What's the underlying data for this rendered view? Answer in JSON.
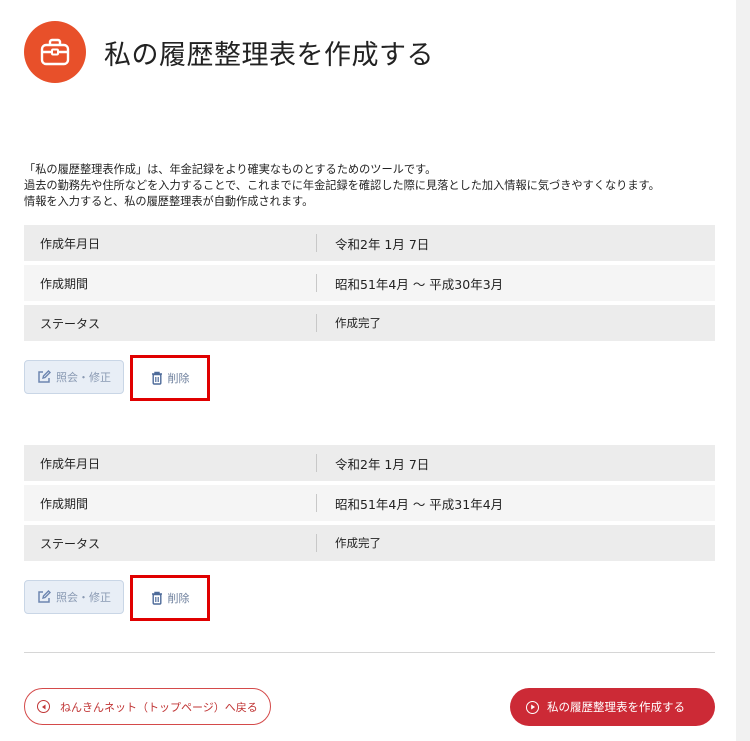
{
  "page": {
    "title": "私の履歴整理表を作成する",
    "icon": "toolbox-icon",
    "accent_color": "#e8502a"
  },
  "intro": {
    "line1": "「私の履歴整理表作成」は、年金記録をより確実なものとするためのツールです。",
    "line2": "過去の勤務先や住所などを入力することで、これまでに年金記録を確認した際に見落とした加入情報に気づきやすくなります。",
    "line3": "情報を入力すると、私の履歴整理表が自動作成されます。"
  },
  "records": [
    {
      "created_label": "作成年月日",
      "created_value": "令和2年 1月 7日",
      "period_label": "作成期間",
      "period_value": "昭和51年4月 ～ 平成30年3月",
      "status_label": "ステータス",
      "status_value": "作成完了",
      "edit_label": "照会・修正",
      "delete_label": "削除"
    },
    {
      "created_label": "作成年月日",
      "created_value": "令和2年 1月 7日",
      "period_label": "作成期間",
      "period_value": "昭和51年4月 ～ 平成31年4月",
      "status_label": "ステータス",
      "status_value": "作成完了",
      "edit_label": "照会・修正",
      "delete_label": "削除"
    }
  ],
  "footer": {
    "back_label": "ねんきんネット（トップページ）へ戻る",
    "create_label": "私の履歴整理表を作成する",
    "create_color": "#cc2a36"
  }
}
